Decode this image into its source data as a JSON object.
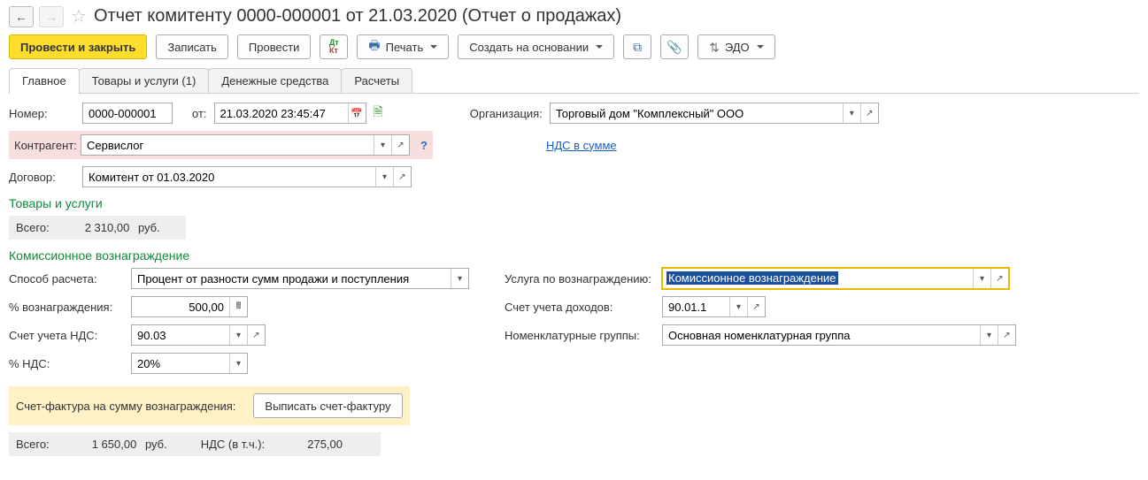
{
  "header": {
    "title": "Отчет комитенту 0000-000001 от 21.03.2020 (Отчет о продажах)"
  },
  "toolbar": {
    "post_close": "Провести и закрыть",
    "save": "Записать",
    "post": "Провести",
    "print": "Печать",
    "create_based": "Создать на основании",
    "edo": "ЭДО"
  },
  "tabs": [
    {
      "label": "Главное",
      "active": true
    },
    {
      "label": "Товары и услуги (1)",
      "active": false
    },
    {
      "label": "Денежные средства",
      "active": false
    },
    {
      "label": "Расчеты",
      "active": false
    }
  ],
  "fields": {
    "number_label": "Номер:",
    "number": "0000-000001",
    "from_label": "от:",
    "date": "21.03.2020 23:45:47",
    "org_label": "Организация:",
    "org": "Торговый дом \"Комплексный\" ООО",
    "counterparty_label": "Контрагент:",
    "counterparty": "Сервислог",
    "vat_link": "НДС в сумме",
    "contract_label": "Договор:",
    "contract": "Комитент от 01.03.2020"
  },
  "goods": {
    "title": "Товары и услуги",
    "total_label": "Всего:",
    "total": "2 310,00",
    "currency": "руб."
  },
  "commission": {
    "title": "Комиссионное вознаграждение",
    "method_label": "Способ расчета:",
    "method": "Процент от разности сумм продажи и поступления",
    "percent_label": "% вознаграждения:",
    "percent": "500,00",
    "vat_account_label": "Счет учета НДС:",
    "vat_account": "90.03",
    "vat_percent_label": "% НДС:",
    "vat_percent": "20%",
    "service_label": "Услуга по вознаграждению:",
    "service": "Комиссионное вознаграждение",
    "income_account_label": "Счет учета доходов:",
    "income_account": "90.01.1",
    "nomen_group_label": "Номенклатурные группы:",
    "nomen_group": "Основная номенклатурная группа",
    "invoice_label": "Счет-фактура на сумму вознаграждения:",
    "invoice_btn": "Выписать счет-фактуру",
    "totals": {
      "total_label": "Всего:",
      "total": "1 650,00",
      "currency": "руб.",
      "vat_incl_label": "НДС (в т.ч.):",
      "vat_incl": "275,00"
    }
  }
}
